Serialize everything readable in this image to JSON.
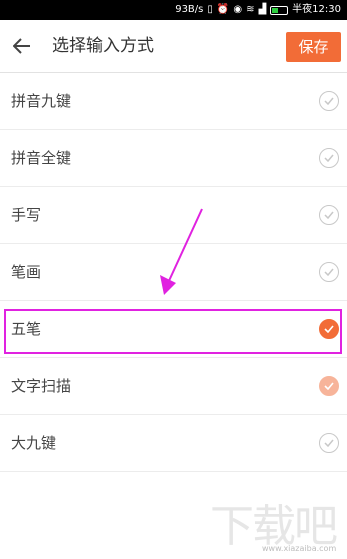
{
  "status_bar": {
    "net_speed": "93B/s",
    "time_label": "半夜12:30",
    "battery_level": "1"
  },
  "header": {
    "title": "选择输入方式",
    "save_label": "保存"
  },
  "options": [
    {
      "label": "拼音九键",
      "state": "unchecked"
    },
    {
      "label": "拼音全键",
      "state": "unchecked"
    },
    {
      "label": "手写",
      "state": "unchecked"
    },
    {
      "label": "笔画",
      "state": "unchecked"
    },
    {
      "label": "五笔",
      "state": "checked"
    },
    {
      "label": "文字扫描",
      "state": "checked-dim"
    },
    {
      "label": "大九键",
      "state": "unchecked"
    }
  ],
  "colors": {
    "accent": "#f26c37",
    "annotation": "#e022e0"
  },
  "watermark": {
    "url": "www.xiazaiba.com"
  }
}
